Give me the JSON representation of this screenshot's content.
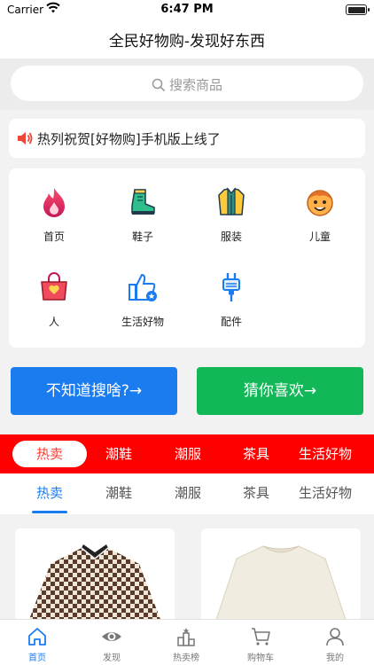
{
  "status_bar": {
    "carrier": "Carrier",
    "time": "6:47 PM"
  },
  "nav": {
    "title": "全民好物购-发现好东西"
  },
  "search": {
    "placeholder": "搜索商品"
  },
  "notice": {
    "text": "热列祝贺[好物购]手机版上线了",
    "icon": "speaker-icon"
  },
  "categories": [
    {
      "label": "首页",
      "icon": "fire-icon"
    },
    {
      "label": "鞋子",
      "icon": "boot-icon"
    },
    {
      "label": "服装",
      "icon": "jacket-icon"
    },
    {
      "label": "儿童",
      "icon": "kid-face-icon"
    },
    {
      "label": "人",
      "icon": "handbag-icon"
    },
    {
      "label": "生活好物",
      "icon": "thumbs-up-icon"
    },
    {
      "label": "配件",
      "icon": "plug-icon"
    }
  ],
  "buttons": {
    "left": "不知道搜啥?→",
    "right": "猜你喜欢→"
  },
  "red_tabs": [
    "热卖",
    "潮鞋",
    "潮服",
    "茶具",
    "生活好物"
  ],
  "white_tabs": [
    "热卖",
    "潮鞋",
    "潮服",
    "茶具",
    "生活好物"
  ],
  "active_tab_index": 0,
  "tabbar": [
    {
      "label": "首页",
      "icon": "home-icon",
      "active": true
    },
    {
      "label": "发现",
      "icon": "eye-icon",
      "active": false
    },
    {
      "label": "热卖榜",
      "icon": "podium-icon",
      "active": false
    },
    {
      "label": "购物车",
      "icon": "cart-icon",
      "active": false
    },
    {
      "label": "我的",
      "icon": "person-icon",
      "active": false
    }
  ],
  "colors": {
    "accent": "#1b7cf0",
    "red": "#ff0000",
    "green": "#12b858"
  }
}
